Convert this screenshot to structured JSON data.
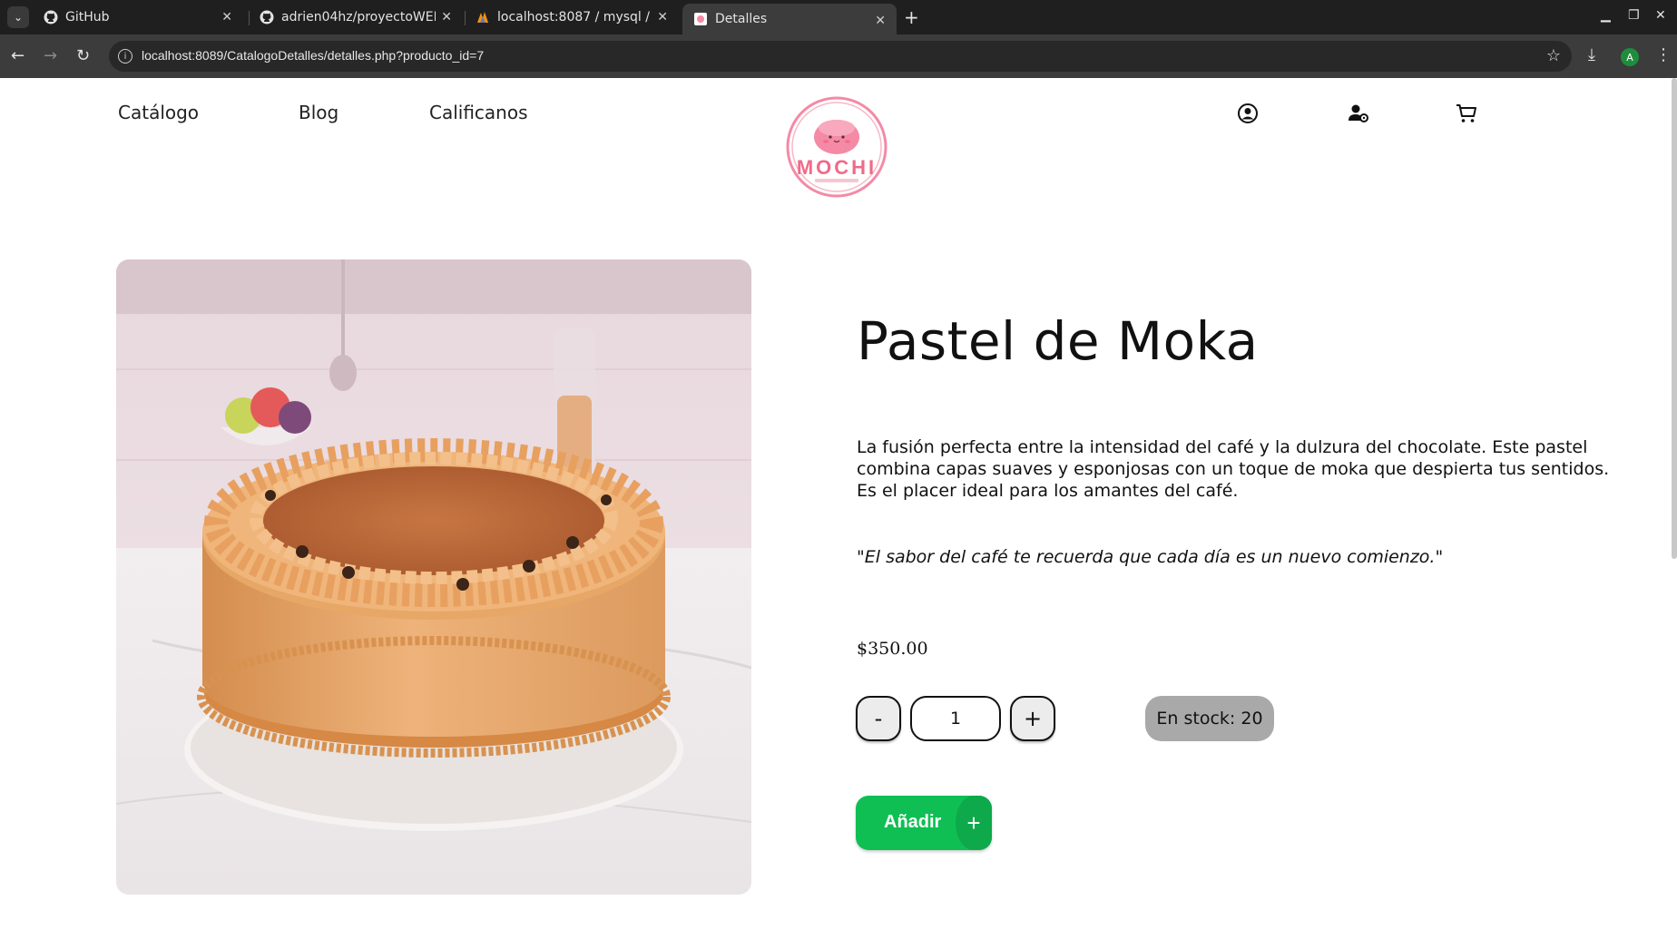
{
  "browser": {
    "tabs": [
      {
        "title": "GitHub",
        "icon": "github-icon"
      },
      {
        "title": "adrien04hz/proyectoWEB",
        "icon": "github-icon"
      },
      {
        "title": "localhost:8087 / mysql / t",
        "icon": "phpmyadmin-icon"
      },
      {
        "title": "Detalles",
        "icon": "mochi-favicon"
      }
    ],
    "url": "localhost:8089/CatalogoDetalles/detalles.php?producto_id=7",
    "profile_initial": "A"
  },
  "header": {
    "nav": [
      "Catálogo",
      "Blog",
      "Calificanos"
    ],
    "logo_text": "MOCHI",
    "icons": [
      "user-circle-icon",
      "user-settings-icon",
      "cart-icon"
    ]
  },
  "product": {
    "title": "Pastel de Moka",
    "description": "La fusión perfecta entre la intensidad del café y la dulzura del chocolate. Este pastel combina capas suaves y esponjosas con un toque de moka que despierta tus sentidos. Es el placer ideal para los amantes del café.",
    "quote": "\"El sabor del café te recuerda que cada día es un nuevo comienzo.\"",
    "price": "$350.00",
    "quantity": "1",
    "decrement_label": "-",
    "increment_label": "+",
    "stock": "En stock: 20",
    "add_label": "Añadir",
    "add_icon_label": "+"
  },
  "colors": {
    "accent_green": "#0fbf54",
    "logo_pink": "#f06a8a",
    "stock_bg": "#a9a9a9"
  }
}
